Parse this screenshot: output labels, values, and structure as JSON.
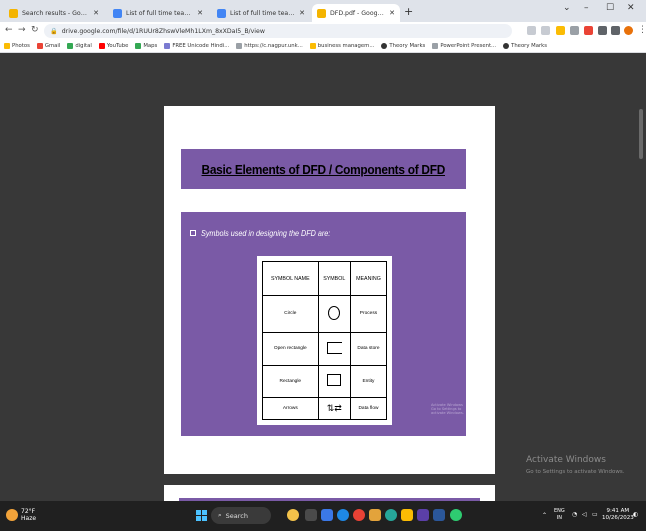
{
  "browser": {
    "tabs": [
      {
        "label": "Search results - Google Drive",
        "active": false,
        "favicon": "google-drive-icon",
        "color": "#f4b400"
      },
      {
        "label": "List of full time teachers google",
        "active": false,
        "favicon": "google-sheets-icon",
        "color": "#4285f4"
      },
      {
        "label": "List of full time teachers ICT22",
        "active": false,
        "favicon": "google-sheets-icon",
        "color": "#4285f4"
      },
      {
        "label": "DFD.pdf - Google Drive",
        "active": true,
        "favicon": "google-drive-icon",
        "color": "#f4b400"
      }
    ],
    "new_tab": "+",
    "window_controls": {
      "minimize": "–",
      "maximize": "☐",
      "close": "✕"
    },
    "address": "drive.google.com/file/d/1RUUr8ZhswVleMh1LXm_8xXDaI5_B/view",
    "bookmarks": [
      {
        "label": "Photos",
        "color": "#fbbc04"
      },
      {
        "label": "Gmail",
        "color": "#ea4335"
      },
      {
        "label": "digital",
        "color": "#34a853"
      },
      {
        "label": "YouTube",
        "color": "#ff0000"
      },
      {
        "label": "Maps",
        "color": "#34a853"
      },
      {
        "label": "FREE Unicode Hindi...",
        "color": "#7b7bd1"
      },
      {
        "label": "https://c.nagpur.unk...",
        "color": "#9aa0a6"
      },
      {
        "label": "business managem...",
        "color": "#fbbc04"
      },
      {
        "label": "Theory Marks",
        "color": "#333333"
      },
      {
        "label": "PowerPoint Present...",
        "color": "#9aa0a6"
      },
      {
        "label": "Theory Marks",
        "color": "#333333"
      }
    ]
  },
  "slide": {
    "title": "Basic Elements of DFD / Components of DFD",
    "bullet": "Symbols used in designing the DFD are:",
    "table": {
      "headers": [
        "SYMBOL NAME",
        "SYMBOL",
        "MEANING"
      ],
      "rows": [
        {
          "name": "Circle",
          "symbol": "circle",
          "meaning": "Process"
        },
        {
          "name": "Open rectangle",
          "symbol": "open-rectangle",
          "meaning": "Data store"
        },
        {
          "name": "Rectangle",
          "symbol": "rectangle",
          "meaning": "Entity"
        },
        {
          "name": "Arrows",
          "symbol": "arrows",
          "meaning": "Data flow"
        }
      ],
      "arrows_glyph": "⇅⇄"
    },
    "watermark_line1": "Activate Windows",
    "watermark_line2": "Go to Settings to activate Windows.",
    "colors": {
      "slide_purple": "#7a5aa6"
    }
  },
  "os_watermark": {
    "title": "Activate Windows",
    "subtitle": "Go to Settings to activate Windows."
  },
  "taskbar": {
    "weather_temp": "72°F",
    "weather_desc": "Haze",
    "search_label": "Search",
    "tray_lang": "ENG",
    "tray_region": "IN",
    "time": "9:41 AM",
    "date": "10/26/2023"
  }
}
